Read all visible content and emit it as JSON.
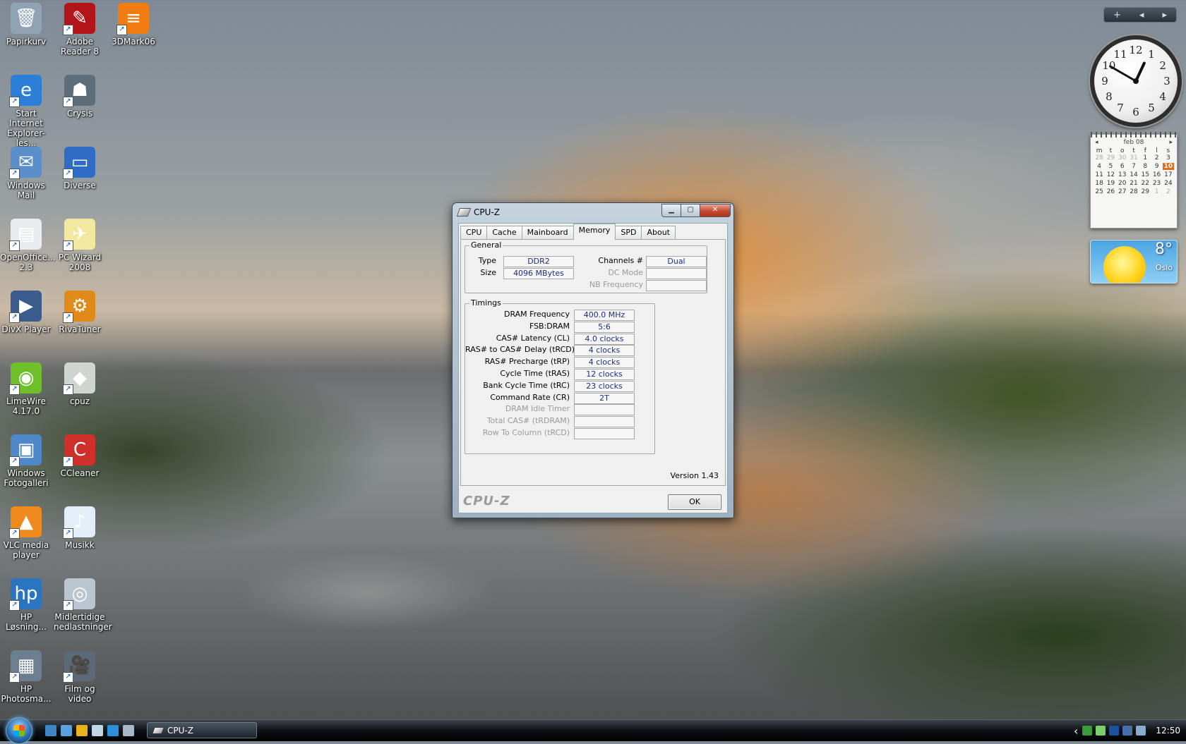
{
  "desktop": {
    "icons": [
      {
        "label": "Papirkurv",
        "color": "#8fa3b5",
        "glyph": "🗑"
      },
      {
        "label": "Adobe Reader 8",
        "color": "#b3141a",
        "glyph": "✎"
      },
      {
        "label": "3DMark06",
        "color": "#f07c12",
        "glyph": "≡"
      },
      {
        "label": "Start Internet Explorer-les...",
        "color": "#2b7fd6",
        "glyph": "e"
      },
      {
        "label": "Crysis",
        "color": "#5d6d7a",
        "glyph": "☗"
      },
      {
        "label": "Windows Mail",
        "color": "#5a8fc9",
        "glyph": "✉"
      },
      {
        "label": "Diverse",
        "color": "#2f6cc6",
        "glyph": "▭"
      },
      {
        "label": "OpenOffice... 2.3",
        "color": "#e8ecef",
        "glyph": "▤"
      },
      {
        "label": "PC Wizard 2008",
        "color": "#f3e8a0",
        "glyph": "✈"
      },
      {
        "label": "DivX Player",
        "color": "#3a5b8c",
        "glyph": "▶"
      },
      {
        "label": "RivaTuner",
        "color": "#e08a1a",
        "glyph": "⚙"
      },
      {
        "label": "LimeWire 4.17.0",
        "color": "#6fbf2a",
        "glyph": "◉"
      },
      {
        "label": "cpuz",
        "color": "#cfd6cf",
        "glyph": "◆"
      },
      {
        "label": "Windows Fotogalleri",
        "color": "#4e88c8",
        "glyph": "▣"
      },
      {
        "label": "CCleaner",
        "color": "#d0302a",
        "glyph": "C"
      },
      {
        "label": "VLC media player",
        "color": "#f08a1c",
        "glyph": "▲"
      },
      {
        "label": "Musikk",
        "color": "#e3eef8",
        "glyph": "♪"
      },
      {
        "label": "HP Løsning...",
        "color": "#2a74c0",
        "glyph": "hp"
      },
      {
        "label": "Midlertidige nedlastninger",
        "color": "#b9c6d1",
        "glyph": "◎"
      },
      {
        "label": "HP Photosma...",
        "color": "#6d7f8e",
        "glyph": "▦"
      },
      {
        "label": "Film og video",
        "color": "#5c6a78",
        "glyph": "🎥"
      }
    ]
  },
  "gadgets": {
    "sidebar_controls": {
      "add": "+",
      "prev": "◂",
      "next": "▸"
    },
    "clock": {
      "numbers": [
        "12",
        "1",
        "2",
        "3",
        "4",
        "5",
        "6",
        "7",
        "8",
        "9",
        "10",
        "11"
      ],
      "time": "12:50"
    },
    "calendar": {
      "month": "feb 08",
      "prev": "◂",
      "next": "▸",
      "weekdays": [
        "m",
        "t",
        "o",
        "t",
        "f",
        "l",
        "s"
      ],
      "days": [
        {
          "d": "28",
          "dim": true
        },
        {
          "d": "29",
          "dim": true
        },
        {
          "d": "30",
          "dim": true
        },
        {
          "d": "31",
          "dim": true
        },
        {
          "d": "1"
        },
        {
          "d": "2"
        },
        {
          "d": "3"
        },
        {
          "d": "4"
        },
        {
          "d": "5"
        },
        {
          "d": "6"
        },
        {
          "d": "7"
        },
        {
          "d": "8"
        },
        {
          "d": "9"
        },
        {
          "d": "10",
          "today": true
        },
        {
          "d": "11"
        },
        {
          "d": "12"
        },
        {
          "d": "13"
        },
        {
          "d": "14"
        },
        {
          "d": "15"
        },
        {
          "d": "16"
        },
        {
          "d": "17"
        },
        {
          "d": "18"
        },
        {
          "d": "19"
        },
        {
          "d": "20"
        },
        {
          "d": "21"
        },
        {
          "d": "22"
        },
        {
          "d": "23"
        },
        {
          "d": "24"
        },
        {
          "d": "25"
        },
        {
          "d": "26"
        },
        {
          "d": "27"
        },
        {
          "d": "28"
        },
        {
          "d": "29"
        },
        {
          "d": "1",
          "dim": true
        },
        {
          "d": "2",
          "dim": true
        }
      ]
    },
    "weather": {
      "temp": "8°",
      "city": "Oslo"
    }
  },
  "window": {
    "title": "CPU-Z",
    "buttons": {
      "min": "▁",
      "max": "▢",
      "close": "✕"
    },
    "tabs": [
      "CPU",
      "Cache",
      "Mainboard",
      "Memory",
      "SPD",
      "About"
    ],
    "active_tab": "Memory",
    "general": {
      "legend": "General",
      "type_label": "Type",
      "type_value": "DDR2",
      "size_label": "Size",
      "size_value": "4096 MBytes",
      "channels_label": "Channels #",
      "channels_value": "Dual",
      "dcmode_label": "DC Mode",
      "dcmode_value": "",
      "nbfreq_label": "NB Frequency",
      "nbfreq_value": ""
    },
    "timings": {
      "legend": "Timings",
      "rows": [
        {
          "label": "DRAM Frequency",
          "value": "400.0 MHz",
          "disabled": false
        },
        {
          "label": "FSB:DRAM",
          "value": "5:6",
          "disabled": false
        },
        {
          "label": "CAS# Latency (CL)",
          "value": "4.0 clocks",
          "disabled": false
        },
        {
          "label": "RAS# to CAS# Delay (tRCD)",
          "value": "4 clocks",
          "disabled": false
        },
        {
          "label": "RAS# Precharge (tRP)",
          "value": "4 clocks",
          "disabled": false
        },
        {
          "label": "Cycle Time (tRAS)",
          "value": "12 clocks",
          "disabled": false
        },
        {
          "label": "Bank Cycle Time (tRC)",
          "value": "23 clocks",
          "disabled": false
        },
        {
          "label": "Command Rate (CR)",
          "value": "2T",
          "disabled": false
        },
        {
          "label": "DRAM Idle Timer",
          "value": "",
          "disabled": true
        },
        {
          "label": "Total CAS# (tRDRAM)",
          "value": "",
          "disabled": true
        },
        {
          "label": "Row To Column (tRCD)",
          "value": "",
          "disabled": true
        }
      ]
    },
    "version": "Version 1.43",
    "brand": "CPU-Z",
    "ok_label": "OK"
  },
  "taskbar": {
    "task_label": "CPU-Z",
    "clock": "12:50",
    "tray_expand": "‹",
    "quick_launch_colors": [
      "#3f86c7",
      "#5aa1e0",
      "#e9b21c",
      "#c0d5e8",
      "#2b8fd9",
      "#a8b8c8"
    ],
    "tray_colors": [
      "#3a9a3a",
      "#7ccf6a",
      "#1c4fa0",
      "#4a6ea8",
      "#88aacc"
    ]
  }
}
